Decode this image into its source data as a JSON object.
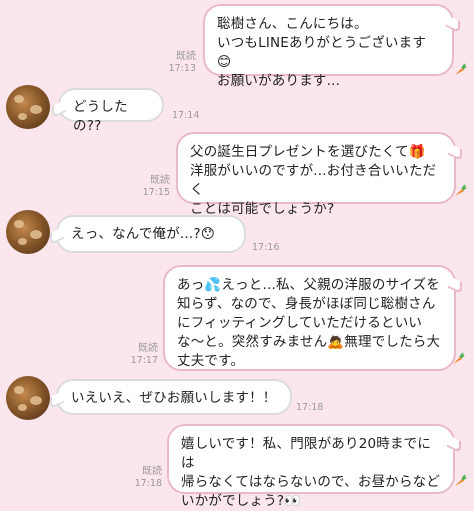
{
  "messages": [
    {
      "id": "m1",
      "sender": "me",
      "text": "聡樹さん、こんにちは。\nいつもLINEありがとうございます😊\nお願いがあります...",
      "read": "既読",
      "time": "17:13"
    },
    {
      "id": "m2",
      "sender": "other",
      "text": "どうしたの??",
      "time": "17:14"
    },
    {
      "id": "m3",
      "sender": "me",
      "text": "父の誕生日プレゼントを選びたくて🎁\n洋服がいいのですが...お付き合いいただく\nことは可能でしょうか?",
      "read": "既読",
      "time": "17:15"
    },
    {
      "id": "m4",
      "sender": "other",
      "text": "えっ、なんで俺が...?😯",
      "time": "17:16"
    },
    {
      "id": "m5",
      "sender": "me",
      "text": "あっ💦えっと...私、父親の洋服のサイズを\n知らず、なので、身長がほぼ同じ聡樹さん\nにフィッティングしていただけるといい\nな〜と。突然すみません🙇無理でしたら大\n丈夫です。",
      "read": "既読",
      "time": "17:17"
    },
    {
      "id": "m6",
      "sender": "other",
      "text": "いえいえ、ぜひお願いします！！",
      "time": "17:18"
    },
    {
      "id": "m7",
      "sender": "me",
      "text": "嬉しいです！私、門限があり20時までには\n帰らなくてはならないので、お昼からなど\nいかがでしょう?👀",
      "read": "既読",
      "time": "17:18"
    }
  ],
  "colors": {
    "background": "#fbe6ee",
    "out_border": "#e9b9cb",
    "in_border": "#dcdcdc"
  },
  "icons": {
    "stamp": "carrot-icon",
    "avatar": "contact-avatar"
  }
}
